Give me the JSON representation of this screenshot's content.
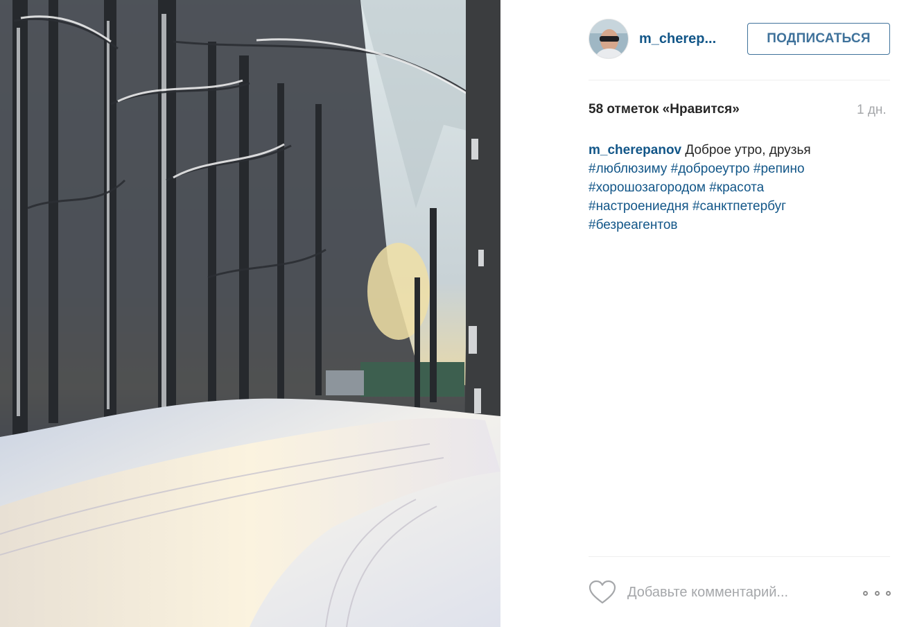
{
  "post": {
    "photo_icon": "winter-forest-photo",
    "author": {
      "username_short": "m_cherep...",
      "username": "m_cherepanov",
      "avatar_icon": "user-avatar"
    },
    "follow_label": "ПОДПИСАТЬСЯ",
    "likes_text": "58 отметок «Нравится»",
    "time_ago": "1 дн.",
    "caption": {
      "text": "Доброе утро, друзья",
      "hashtags": [
        "#люблюзиму",
        "#доброеутро",
        "#репино",
        "#хорошозагородом",
        "#красота",
        "#настроениедня",
        "#санктпетербуг",
        "#безреагентов"
      ]
    },
    "comment_placeholder": "Добавьте комментарий...",
    "like_icon": "heart-icon",
    "more_icon": "more-options-icon"
  },
  "colors": {
    "link": "#125688",
    "button_border": "#3f729b",
    "muted": "#a5a7aa",
    "text": "#262626"
  }
}
